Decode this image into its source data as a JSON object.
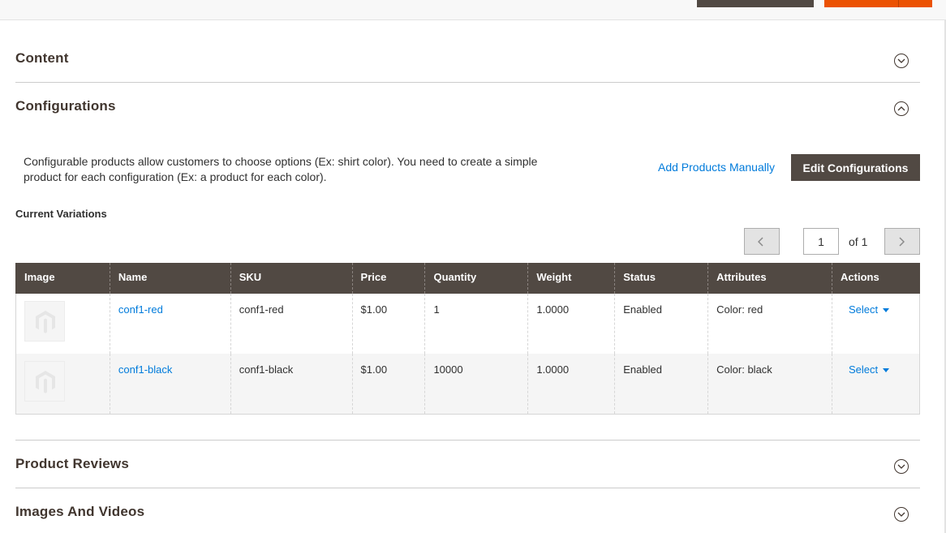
{
  "sections": {
    "content": {
      "title": "Content"
    },
    "configurations": {
      "title": "Configurations"
    },
    "product_reviews": {
      "title": "Product Reviews"
    },
    "images_videos": {
      "title": "Images And Videos"
    }
  },
  "configurations": {
    "description": "Configurable products allow customers to choose options (Ex: shirt color). You need to create a simple product for each configuration (Ex: a product for each color).",
    "add_manually_label": "Add Products Manually",
    "edit_button_label": "Edit Configurations",
    "current_variations_label": "Current Variations"
  },
  "pager": {
    "current_page": "1",
    "of_label": "of 1"
  },
  "grid": {
    "columns": [
      "Image",
      "Name",
      "SKU",
      "Price",
      "Quantity",
      "Weight",
      "Status",
      "Attributes",
      "Actions"
    ],
    "rows": [
      {
        "name": "conf1-red",
        "sku": "conf1-red",
        "price": "$1.00",
        "quantity": "1",
        "weight": "1.0000",
        "status": "Enabled",
        "attributes": "Color: red",
        "action": "Select"
      },
      {
        "name": "conf1-black",
        "sku": "conf1-black",
        "price": "$1.00",
        "quantity": "10000",
        "weight": "1.0000",
        "status": "Enabled",
        "attributes": "Color: black",
        "action": "Select"
      }
    ]
  },
  "colors": {
    "accent": "#eb5202",
    "header_dark": "#514943",
    "link": "#007bdb"
  }
}
